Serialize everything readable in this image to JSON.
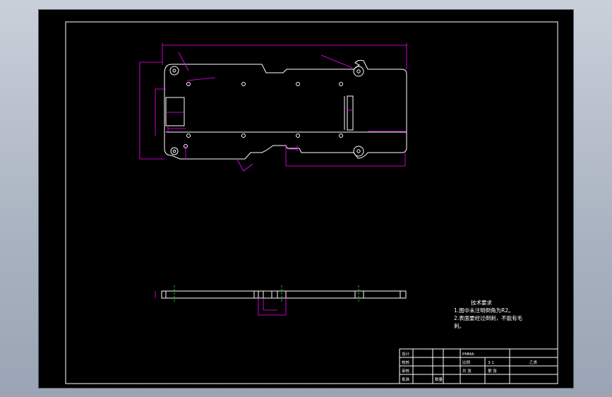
{
  "drawing": {
    "tech_requirements": {
      "title": "技术要求",
      "lines": [
        "1.图中未注明倒角为R2。",
        "2.表面要经过倒刺，不能有毛",
        "刺。"
      ]
    },
    "title_block": {
      "material": "PMMA",
      "part_name": "",
      "scale_label": "比例",
      "scale_value": "3:1",
      "sheet_total": "共 张",
      "sheet_index": "第 张",
      "drawn_label": "设计",
      "checked_label": "校核",
      "audit_label": "审核",
      "approve_label": "批准",
      "count_label": "数量",
      "weight_label": "重量",
      "right_note": "乙类"
    }
  },
  "colors": {
    "background": "#000000",
    "outline": "#ffffff",
    "dimension": "#ff00ff",
    "centerline": "#00ff00"
  }
}
